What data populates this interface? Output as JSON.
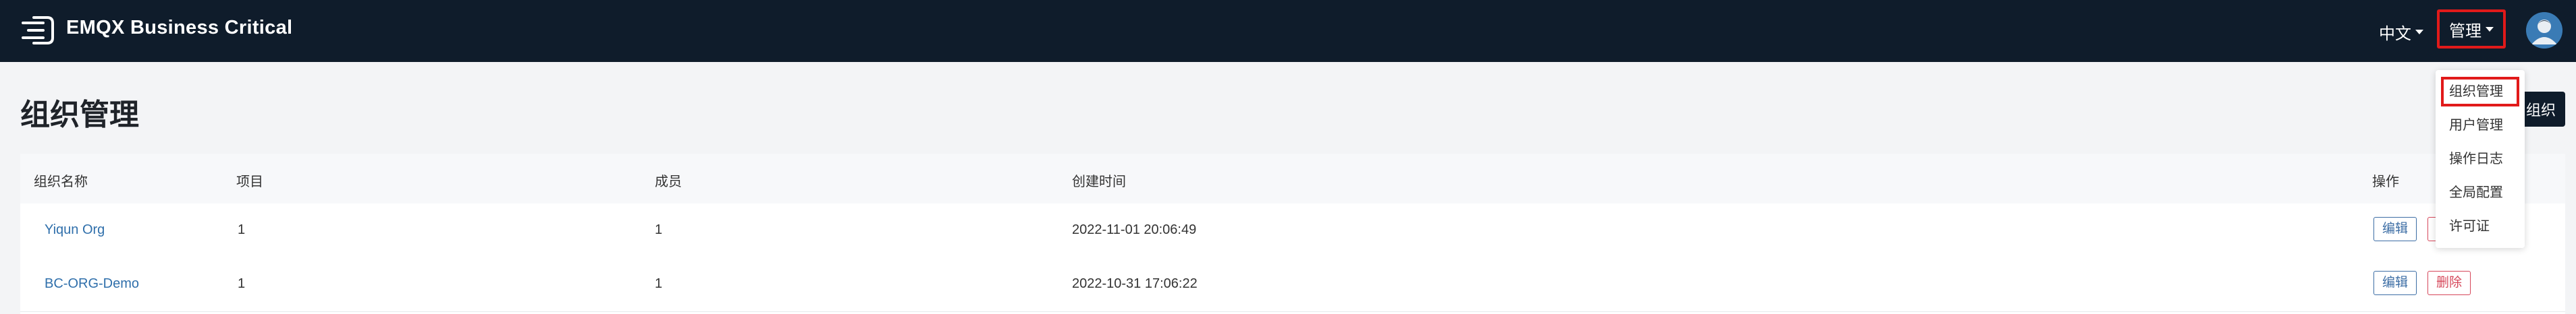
{
  "header": {
    "brand": "EMQX Business Critical",
    "language": "中文",
    "admin_menu_label": "管理",
    "avatar_icon": "user-avatar-icon",
    "background_color": "#0f1c2b"
  },
  "page": {
    "title": "组织管理",
    "create_button_label": "组织"
  },
  "table": {
    "columns": [
      "组织名称",
      "项目",
      "成员",
      "创建时间",
      "操作"
    ],
    "rows": [
      {
        "name": "Yiqun Org",
        "projects": "1",
        "members": "1",
        "created_at": "2022-11-01 20:06:49",
        "edit_label": "编辑",
        "delete_label": "删除"
      },
      {
        "name": "BC-ORG-Demo",
        "projects": "1",
        "members": "1",
        "created_at": "2022-10-31 17:06:22",
        "edit_label": "编辑",
        "delete_label": "删除"
      }
    ]
  },
  "dropdown": {
    "items": [
      {
        "label": "组织管理",
        "active": true
      },
      {
        "label": "用户管理",
        "active": false
      },
      {
        "label": "操作日志",
        "active": false
      },
      {
        "label": "全局配置",
        "active": false
      },
      {
        "label": "许可证",
        "active": false
      }
    ]
  },
  "colors": {
    "link": "#2f6fab",
    "danger": "#d6475a",
    "highlight": "#e11a1a"
  }
}
